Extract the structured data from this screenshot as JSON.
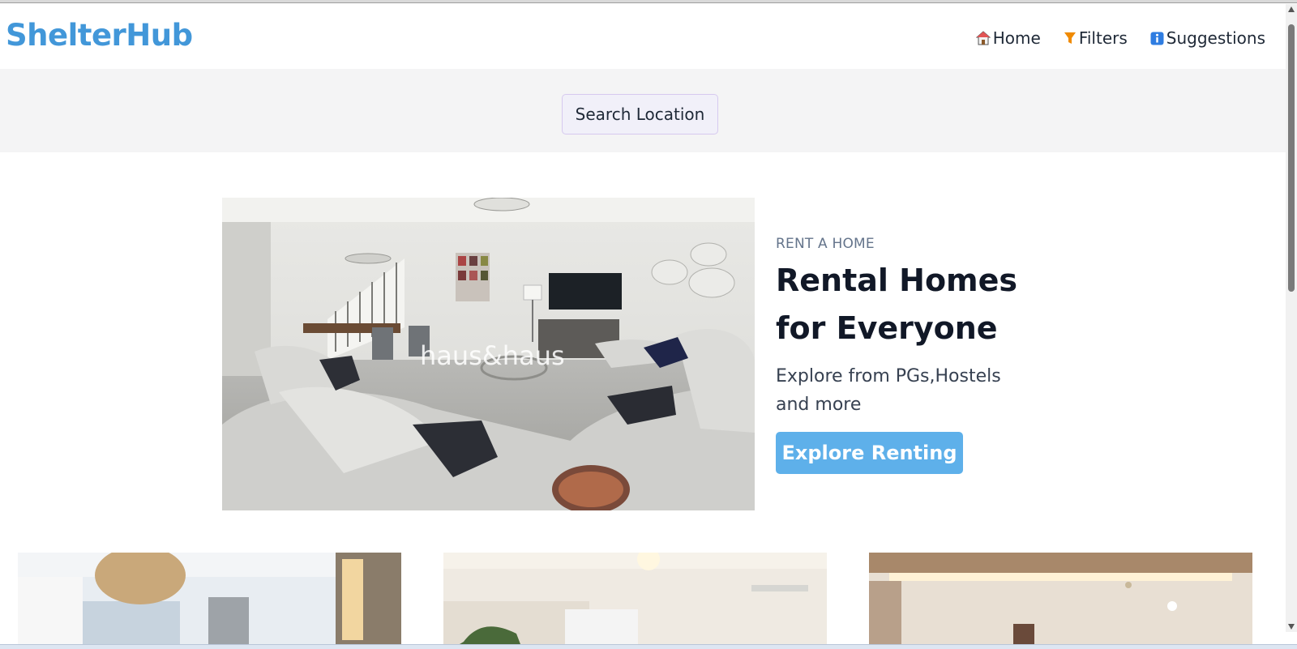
{
  "app": {
    "logo": "ShelterHub"
  },
  "nav": {
    "home_label": "Home",
    "filters_label": "Filters",
    "suggestions_label": "Suggestions"
  },
  "search": {
    "button_label": "Search Location"
  },
  "hero": {
    "eyebrow": "RENT A HOME",
    "title": "Rental Homes for Everyone",
    "subtitle": "Explore from PGs,Hostels and more",
    "cta_label": "Explore Renting",
    "image_watermark": "haus&haus"
  },
  "colors": {
    "brand": "#4297d9",
    "cta": "#5eb0ea",
    "band": "#f4f4f5"
  },
  "icons": [
    "home-icon",
    "filter-icon",
    "info-icon"
  ]
}
